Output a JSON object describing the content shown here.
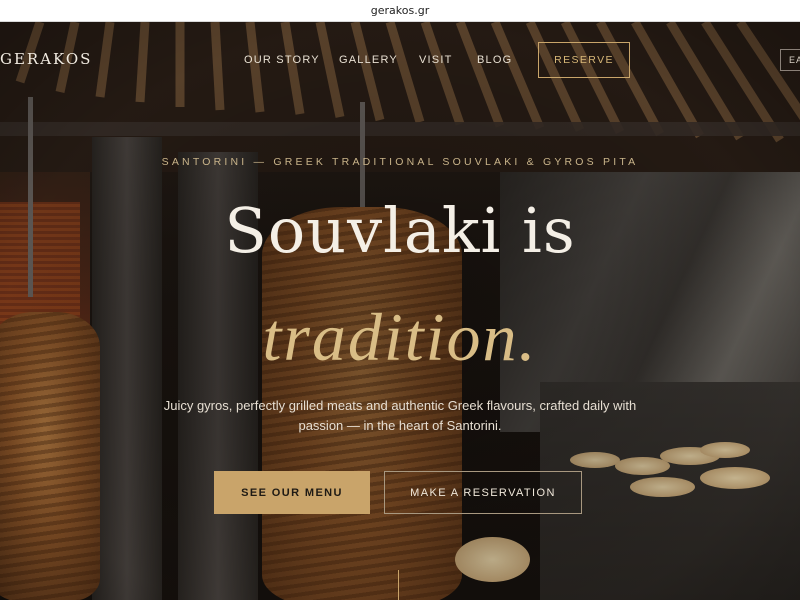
{
  "browser": {
    "url": "gerakos.gr"
  },
  "nav": {
    "logo": "GERAKOS",
    "links": [
      "OUR STORY",
      "GALLERY",
      "VISIT",
      "BLOG"
    ],
    "reserve_label": "RESERVE",
    "lang_label": "EA"
  },
  "hero": {
    "eyebrow": "SANTORINI — GREEK TRADITIONAL SOUVLAKI & GYROS PITA",
    "headline_line1": "Souvlaki is",
    "headline_line2": "tradition.",
    "subtitle": "Juicy gyros, perfectly grilled meats and authentic Greek flavours, crafted daily with passion — in the heart of Santorini.",
    "primary_cta": "SEE OUR MENU",
    "secondary_cta": "MAKE A RESERVATION"
  },
  "colors": {
    "accent_gold": "#c9a46a",
    "headline_white": "#f4efe6",
    "headline_gold": "#d9bd86"
  }
}
